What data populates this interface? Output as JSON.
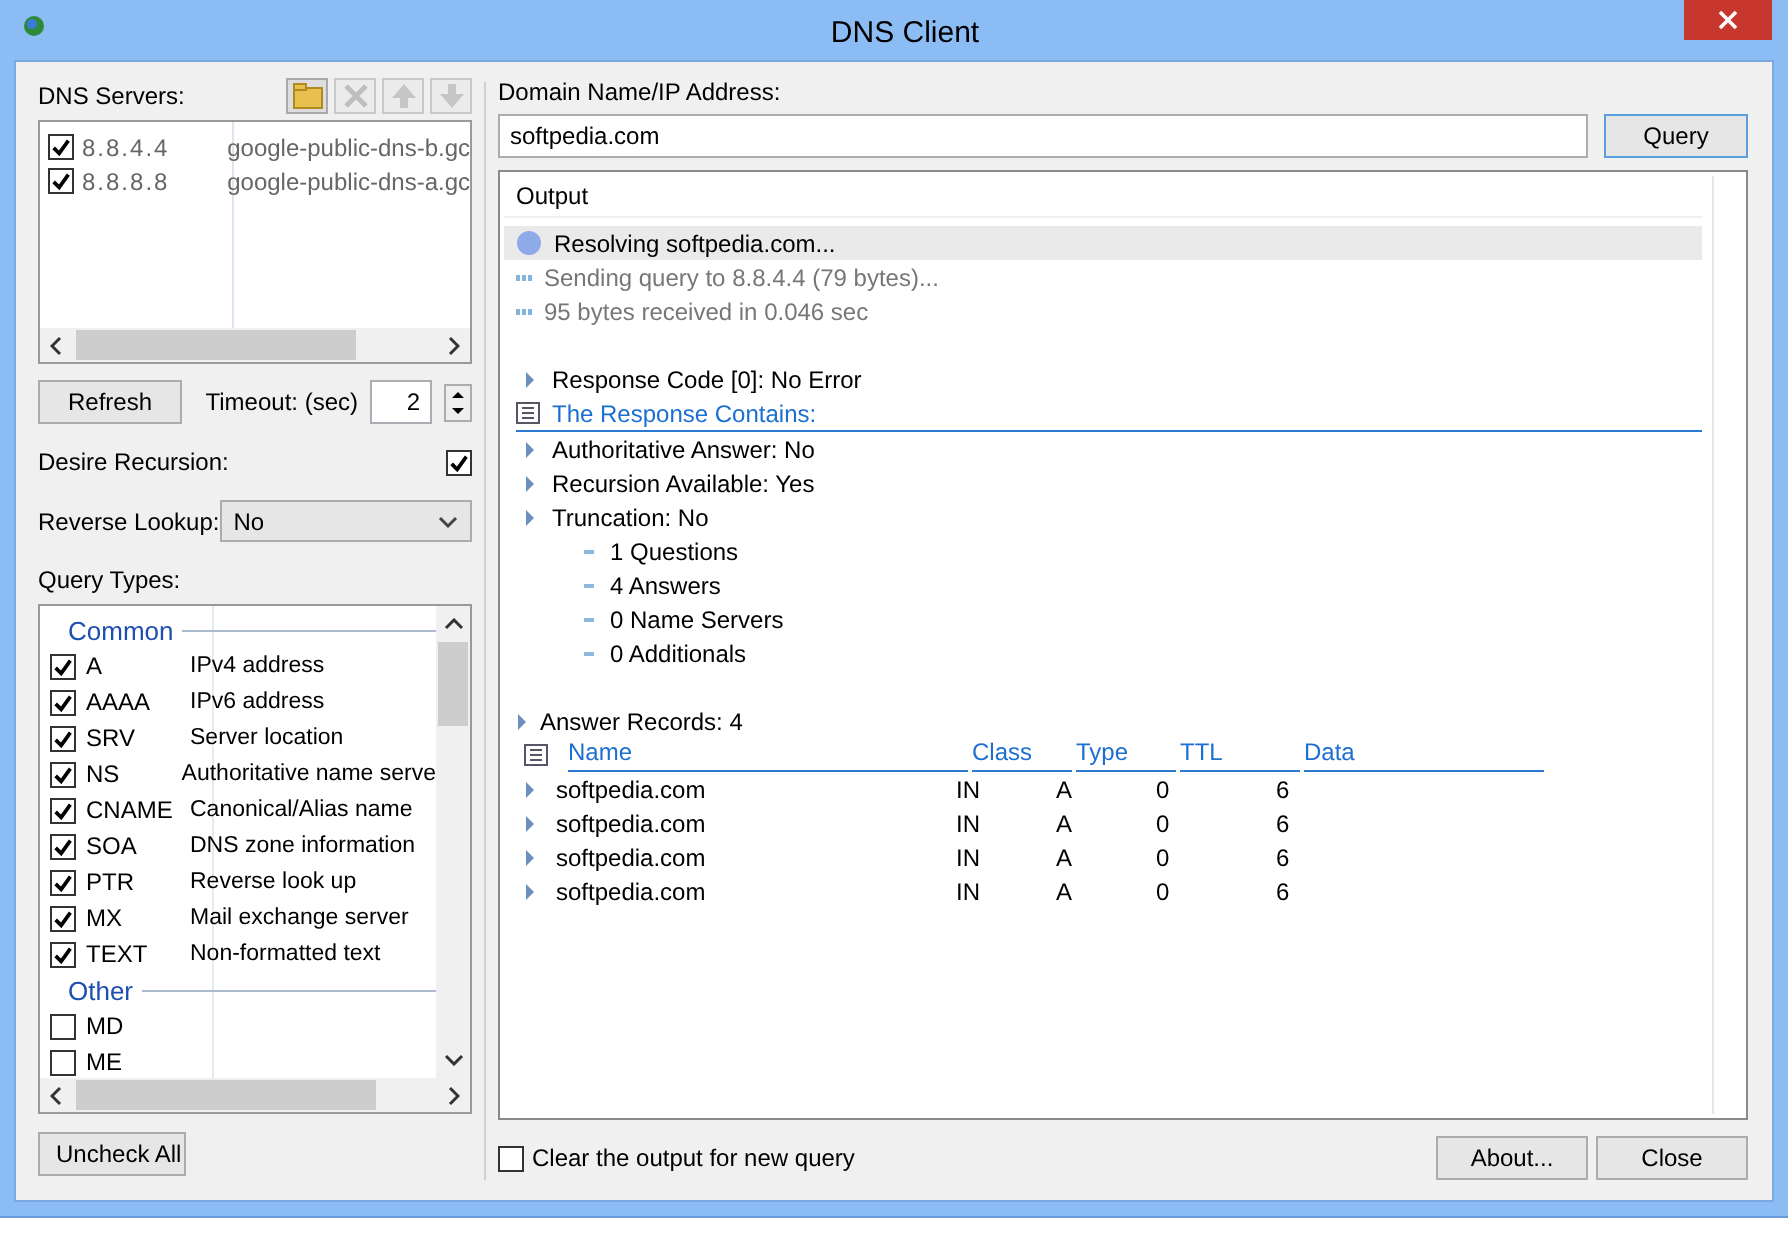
{
  "window": {
    "title": "DNS Client"
  },
  "dns_servers": {
    "label": "DNS Servers:",
    "toolbar": [
      {
        "kind": "add",
        "disabled": false
      },
      {
        "kind": "delete",
        "disabled": true
      },
      {
        "kind": "up",
        "disabled": true
      },
      {
        "kind": "down",
        "disabled": true
      }
    ],
    "servers": [
      {
        "address": "8.8.4.4",
        "host": "google-public-dns-b.gc",
        "checked": true
      },
      {
        "address": "8.8.8.8",
        "host": "google-public-dns-a.gc",
        "checked": true
      }
    ]
  },
  "refresh_button": "Refresh",
  "timeout": {
    "label": "Timeout: (sec)",
    "value": "2"
  },
  "desire_recursion": {
    "label": "Desire Recursion:",
    "checked": true
  },
  "reverse_lookup": {
    "label": "Reverse Lookup:",
    "value": "No"
  },
  "query_types": {
    "label": "Query Types:",
    "groups": [
      {
        "name": "Common",
        "types": [
          {
            "code": "A",
            "description": "IPv4 address",
            "checked": true
          },
          {
            "code": "AAAA",
            "description": "IPv6 address",
            "checked": true
          },
          {
            "code": "SRV",
            "description": "Server location",
            "checked": true
          },
          {
            "code": "NS",
            "description": "Authoritative name serve",
            "checked": true
          },
          {
            "code": "CNAME",
            "description": "Canonical/Alias name",
            "checked": true
          },
          {
            "code": "SOA",
            "description": "DNS zone information",
            "checked": true
          },
          {
            "code": "PTR",
            "description": "Reverse look up",
            "checked": true
          },
          {
            "code": "MX",
            "description": "Mail exchange server",
            "checked": true
          },
          {
            "code": "TEXT",
            "description": "Non-formatted text",
            "checked": true
          }
        ]
      },
      {
        "name": "Other",
        "types": [
          {
            "code": "MD",
            "checked": false
          },
          {
            "code": "ME",
            "checked": false
          }
        ]
      }
    ]
  },
  "uncheck_all_button": "Uncheck All",
  "domain": {
    "label": "Domain Name/IP Address:",
    "value": "softpedia.com"
  },
  "query_button": "Query",
  "output": {
    "header": "Output",
    "log": [
      {
        "kind": "status",
        "text": "Resolving softpedia.com...",
        "selected": true
      },
      {
        "kind": "progress",
        "text": "Sending query to 8.8.4.4 (79 bytes)...",
        "selected": false
      },
      {
        "kind": "progress",
        "text": "95 bytes received in 0.046 sec",
        "selected": false
      }
    ],
    "response": [
      {
        "kind": "node",
        "text": "Response Code [0]: No Error"
      },
      {
        "kind": "section",
        "text": "The Response Contains:"
      },
      {
        "kind": "node",
        "text": "Authoritative Answer: No"
      },
      {
        "kind": "node",
        "text": "Recursion Available: Yes"
      },
      {
        "kind": "node",
        "text": "Truncation: No"
      },
      {
        "kind": "leaf",
        "text": "1 Questions"
      },
      {
        "kind": "leaf",
        "text": "4 Answers"
      },
      {
        "kind": "leaf",
        "text": "0 Name Servers"
      },
      {
        "kind": "leaf",
        "text": "0 Additionals"
      }
    ],
    "answers": {
      "title": "Answer Records: 4",
      "columns": [
        "Name",
        "Class",
        "Type",
        "TTL",
        "Data"
      ],
      "rows": [
        [
          "softpedia.com",
          "IN",
          "A",
          "0",
          "6"
        ],
        [
          "softpedia.com",
          "IN",
          "A",
          "0",
          "6"
        ],
        [
          "softpedia.com",
          "IN",
          "A",
          "0",
          "6"
        ],
        [
          "softpedia.com",
          "IN",
          "A",
          "0",
          "6"
        ]
      ]
    }
  },
  "clear_output": {
    "label": "Clear the output for new query",
    "checked": false
  },
  "buttons": [
    "About...",
    "Close"
  ]
}
